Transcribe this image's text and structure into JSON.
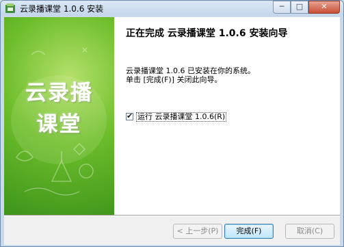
{
  "window": {
    "title": "云录播课堂 1.0.6 安装",
    "controls": {
      "minimize": "─",
      "maximize": "□",
      "close": "✕"
    }
  },
  "side_panel": {
    "logo_line1": "云录播",
    "logo_line2": "课堂"
  },
  "main": {
    "heading": "正在完成 云录播课堂 1.0.6 安装向导",
    "message_line1": "云录播课堂 1.0.6 已安装在你的系统。",
    "message_line2": "单击 [完成(F)] 关闭此向导。",
    "run_checkbox": {
      "label": "运行 云录播课堂 1.0.6(R)",
      "checked": true,
      "mark": "✔"
    }
  },
  "buttons": {
    "back": "< 上一步(P)",
    "finish": "完成(F)",
    "cancel": "取消(C)"
  },
  "colors": {
    "panel_green": "#6cbd2a",
    "titlebar": "#c5d6ea"
  }
}
